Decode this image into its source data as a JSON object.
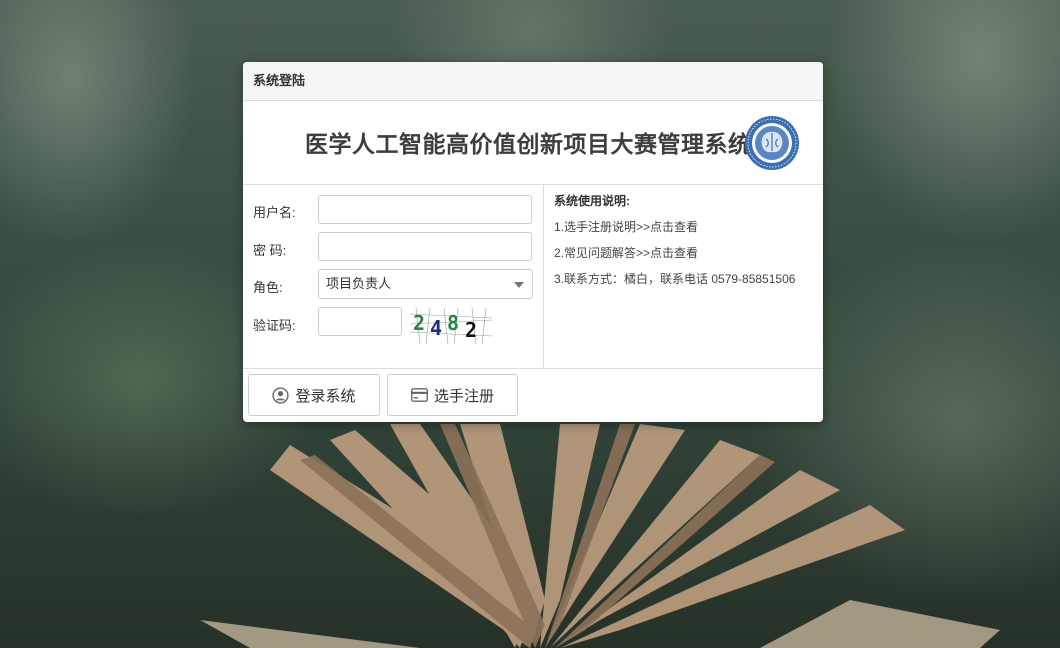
{
  "panel": {
    "title": "系统登陆"
  },
  "banner": {
    "title": "医学人工智能高价值创新项目大赛管理系统"
  },
  "form": {
    "username_label": "用户名:",
    "username_value": "",
    "password_label": "密 码:",
    "password_value": "",
    "role_label": "角色:",
    "role_selected": "项目负责人",
    "captcha_label": "验证码:",
    "captcha_value": "",
    "captcha_digits": [
      "2",
      "4",
      "8",
      "2"
    ]
  },
  "info": {
    "title": "系统使用说明:",
    "lines": [
      "1.选手注册说明>>点击查看",
      "2.常见问题解答>>点击查看",
      "3.联系方式：橘白，联系电话 0579-85851506"
    ]
  },
  "buttons": {
    "login": "登录系统",
    "register": "选手注册"
  },
  "colors": {
    "logo_blue": "#3b6fb5",
    "captcha_green": "#1f8a3b",
    "captcha_navy": "#1c2a8a"
  },
  "icons": {
    "login": "user-circle-icon",
    "register": "credit-card-icon",
    "role_dropdown": "chevron-down-icon"
  }
}
